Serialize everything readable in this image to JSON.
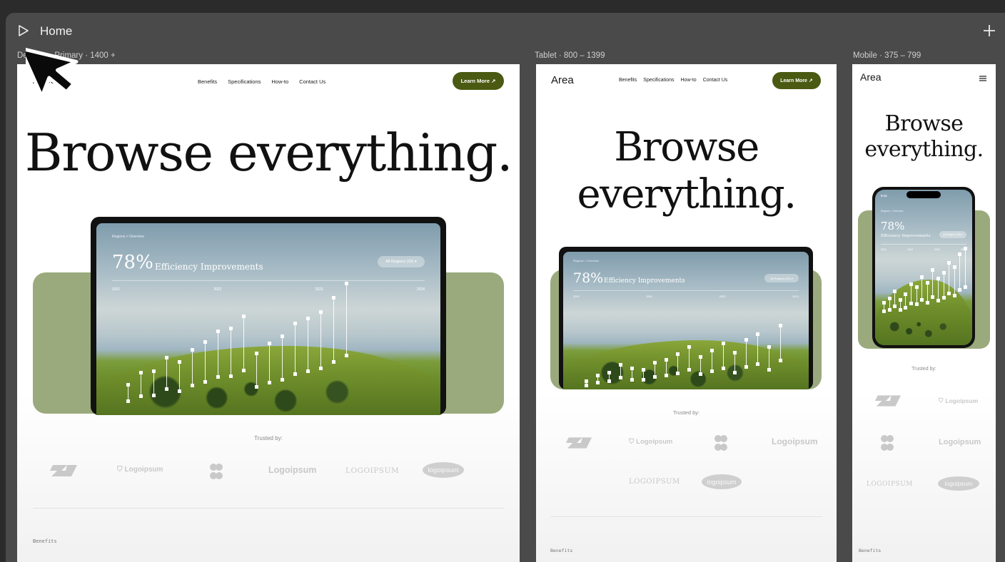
{
  "canvas": {
    "title": "Home"
  },
  "breakpoints": {
    "desktop": {
      "label": "Desktop · Primary · 1400 +"
    },
    "tablet": {
      "label": "Tablet · 800 – 1399"
    },
    "mobile": {
      "label": "Mobile · 375 – 799"
    }
  },
  "site": {
    "logo": "Area",
    "nav": [
      "Benefits",
      "Specifications",
      "How-to",
      "Contact Us"
    ],
    "cta": "Learn More ↗",
    "hero_desktop": "Browse everything.",
    "hero_line1": "Browse",
    "hero_line2": "everything.",
    "screen": {
      "crumb": "Regions > Overview",
      "percent": "78%",
      "label": "Efficiency Improvements",
      "pill": "All Regions (33) ▾",
      "years": [
        "2021",
        "2022",
        "2023",
        "2024"
      ],
      "status_time": "9:41"
    },
    "trusted": "Trusted by:",
    "logos": [
      "Logoipsum",
      "Logoipsum",
      "LOGOIPSUM",
      "logoipsum"
    ],
    "section_label": "Benefits"
  },
  "colors": {
    "brand_green": "#4a5a12",
    "band_green": "#9aaa7d",
    "canvas": "#4a4a4a"
  },
  "icons": {
    "play": "play-icon",
    "add": "plus-icon",
    "menu": "hamburger-menu-icon",
    "cursor": "mouse-pointer-icon"
  }
}
